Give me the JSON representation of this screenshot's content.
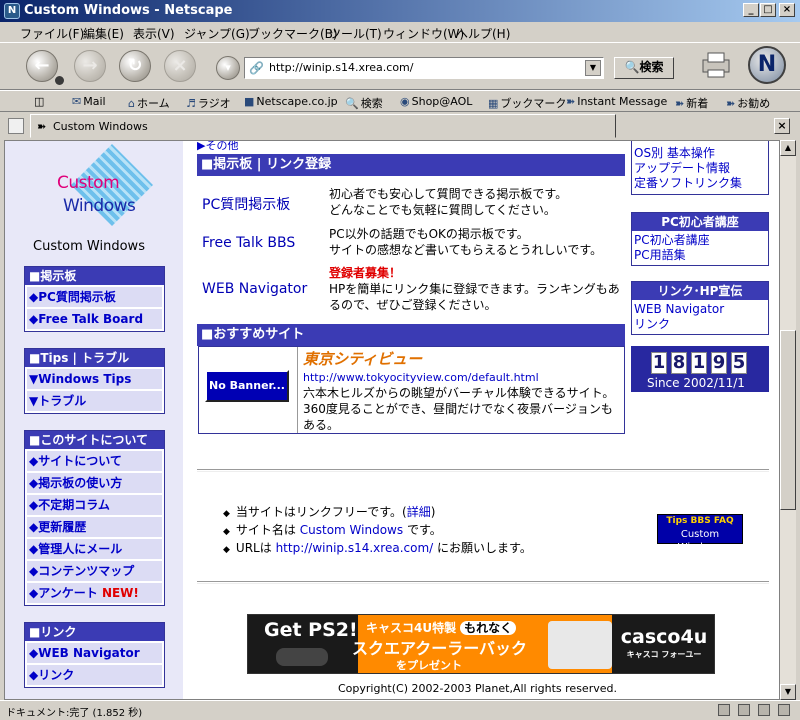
{
  "window": {
    "title": "Custom Windows - Netscape",
    "controls": [
      "_",
      "□",
      "×"
    ],
    "app_icon": "netscape-icon"
  },
  "menu": [
    "ファイル(F)",
    "編集(E)",
    "表示(V)",
    "ジャンプ(G)",
    "ブックマーク(B)",
    "ツール(T)",
    "ウィンドウ(W)",
    "ヘルプ(H)"
  ],
  "toolbar": {
    "url": "http://winip.s14.xrea.com/",
    "search_label": "検索",
    "logo_letter": "N"
  },
  "personal_toolbar": [
    "Mail",
    "ホーム",
    "ラジオ",
    "Netscape.co.jp",
    "検索",
    "Shop@AOL",
    "ブックマーク",
    "Instant Message",
    "新着",
    "お勧め"
  ],
  "tab": {
    "label": "Custom Windows"
  },
  "sidebar": {
    "logo_line1": "Custom",
    "logo_line2": "Windows",
    "site_name": "Custom Windows",
    "sections": [
      {
        "title": "■掲示板",
        "items": [
          "◆PC質問掲示板",
          "◆Free Talk Board"
        ]
      },
      {
        "title": "■Tips | トラブル",
        "items": [
          "▼Windows Tips",
          "▼トラブル"
        ]
      },
      {
        "title": "■このサイトについて",
        "items": [
          "◆サイトについて",
          "◆掲示板の使い方",
          "◆不定期コラム",
          "◆更新履歴",
          "◆管理人にメール",
          "◆コンテンツマップ",
          "◆アンケート"
        ]
      },
      {
        "title": "■リンク",
        "items": [
          "◆WEB Navigator",
          "◆リンク"
        ]
      }
    ],
    "new_badge": "NEW!"
  },
  "main": {
    "partial_link": "▶その他",
    "bbs_header": "■掲示板 | リンク登録",
    "boards": [
      {
        "name": "PC質問掲示板",
        "desc1": "初心者でも安心して質問できる掲示板です。",
        "desc2": "どんなことでも気軽に質問してください。"
      },
      {
        "name": "Free Talk BBS",
        "desc1": "PC以外の話題でもOKの掲示板です。",
        "desc2": "サイトの感想など書いてもらえるとうれしいです。"
      },
      {
        "name": "WEB Navigator",
        "tag": "登録者募集！",
        "desc1": "HPを簡単にリンク集に登録できます。ランキングもあ",
        "desc2": "るので、ぜひご登録ください。"
      }
    ],
    "rec_header": "■おすすめサイト",
    "rec": {
      "banner": "No Banner...",
      "title": "東京シティビュー",
      "url": "http://www.tokyocityview.com/default.html",
      "desc": "六本木ヒルズからの眺望がバーチャル体験できるサイト。360度見ることができ、昼間だけでなく夜景バージョンもある。"
    }
  },
  "right": {
    "top_links": [
      "OS別 基本操作",
      "アップデート情報",
      "定番ソフトリンク集"
    ],
    "pc_box": {
      "title": "PC初心者講座",
      "links": [
        "PC初心者講座",
        "PC用語集"
      ]
    },
    "link_box": {
      "title": "リンク･HP宣伝",
      "links": [
        "WEB Navigator",
        "リンク"
      ]
    },
    "counter": {
      "digits": [
        "1",
        "8",
        "1",
        "9",
        "5"
      ],
      "since": "Since 2002/11/1"
    }
  },
  "footer": {
    "b1_pre": "当サイトはリンクフリーです。(",
    "b1_link": "詳細",
    "b1_post": ")",
    "b2_pre": "サイト名は",
    "b2_link": "Custom Windows",
    "b2_post": "です。",
    "b3_pre": "URLは",
    "b3_link": "http://winip.s14.xrea.com/",
    "b3_post": "にお願いします。",
    "tips_line1": "Tips BBS FAQ",
    "tips_line2": "Custom Windows",
    "ad": {
      "headline": "Get PS2!",
      "line1": "キャスコ4U特製",
      "pill": "もれなく",
      "line2": "スクエアクーラーバック",
      "line3": "をプレゼント",
      "brand": "casco4u",
      "brand_kana": "キャスコ フォーユー"
    },
    "copyright": "Copyright(C) 2002-2003 Planet,All rights reserved."
  },
  "status": {
    "text": "ドキュメント:完了 (1.852 秒)"
  }
}
